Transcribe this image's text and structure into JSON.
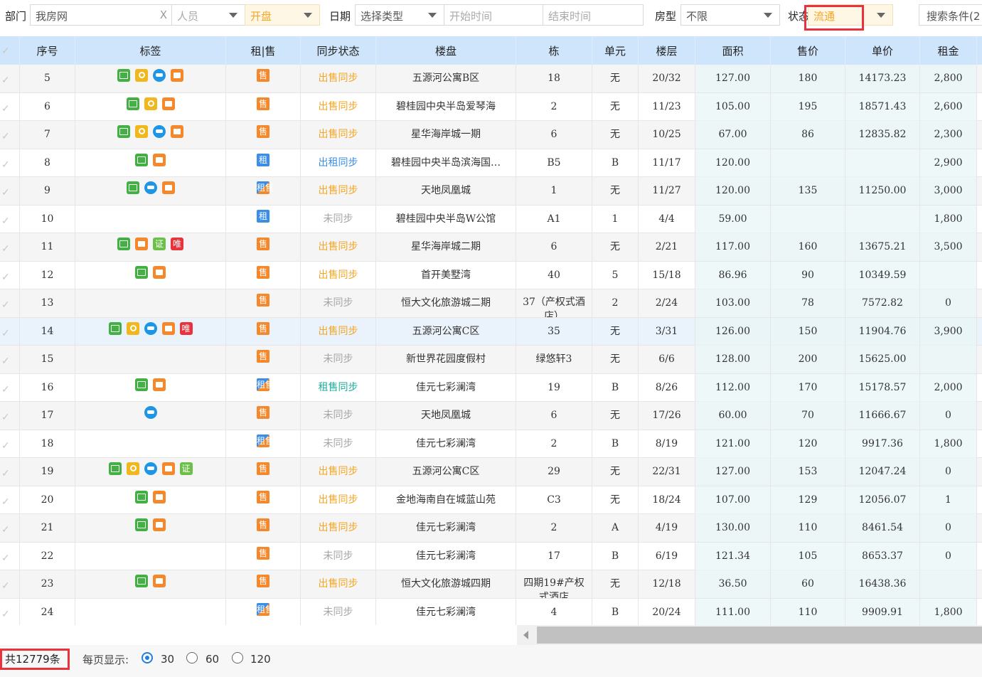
{
  "filters": {
    "dept_label": "部门",
    "dept_value": "我房网",
    "dept_clear": "X",
    "person_placeholder": "人员",
    "open_value": "开盘",
    "date_label": "日期",
    "date_type_placeholder": "选择类型",
    "start_placeholder": "开始时间",
    "end_placeholder": "结束时间",
    "room_label": "房型",
    "room_value": "不限",
    "status_label": "状态",
    "status_value": "流通",
    "search_label": "搜索条件(2"
  },
  "table": {
    "headers": [
      "序号",
      "标签",
      "租|售",
      "同步状态",
      "楼盘",
      "栋",
      "单元",
      "楼层",
      "面积",
      "售价",
      "单价",
      "租金"
    ],
    "rows": [
      {
        "no": "5",
        "tags": [
          "pic",
          "key",
          "hat",
          "vid"
        ],
        "type": "售",
        "type_cls": "sale",
        "sync": "出售同步",
        "sync_cls": "sync-sale",
        "estate": "五源河公寓B区",
        "building": "18",
        "unit": "无",
        "floor": "20/32",
        "area": "127.00",
        "price": "180",
        "unit_price": "14173.23",
        "rent": "2,800"
      },
      {
        "no": "6",
        "tags": [
          "pic",
          "key",
          "vid"
        ],
        "type": "售",
        "type_cls": "sale",
        "sync": "出售同步",
        "sync_cls": "sync-sale",
        "estate": "碧桂园中央半岛爱琴海",
        "building": "2",
        "unit": "无",
        "floor": "11/23",
        "area": "105.00",
        "price": "195",
        "unit_price": "18571.43",
        "rent": "2,600"
      },
      {
        "no": "7",
        "tags": [
          "pic",
          "key",
          "hat",
          "vid"
        ],
        "type": "售",
        "type_cls": "sale",
        "sync": "出售同步",
        "sync_cls": "sync-sale",
        "estate": "星华海岸城一期",
        "building": "6",
        "unit": "无",
        "floor": "10/25",
        "area": "67.00",
        "price": "86",
        "unit_price": "12835.82",
        "rent": "2,300"
      },
      {
        "no": "8",
        "tags": [
          "pic",
          "vid"
        ],
        "type": "租",
        "type_cls": "rent",
        "sync": "出租同步",
        "sync_cls": "sync-rent",
        "estate": "碧桂园中央半岛滨海国…",
        "building": "B5",
        "unit": "B",
        "floor": "11/17",
        "area": "120.00",
        "price": "",
        "unit_price": "",
        "rent": "2,900"
      },
      {
        "no": "9",
        "tags": [
          "pic",
          "hat",
          "vid"
        ],
        "type": "租售",
        "type_cls": "both",
        "sync": "出售同步",
        "sync_cls": "sync-sale",
        "estate": "天地凤凰城",
        "building": "1",
        "unit": "无",
        "floor": "11/27",
        "area": "120.00",
        "price": "135",
        "unit_price": "11250.00",
        "rent": "3,000"
      },
      {
        "no": "10",
        "tags": [],
        "type": "租",
        "type_cls": "rent",
        "sync": "未同步",
        "sync_cls": "sync-none",
        "estate": "碧桂园中央半岛W公馆",
        "building": "A1",
        "unit": "1",
        "floor": "4/4",
        "area": "59.00",
        "price": "",
        "unit_price": "",
        "rent": "1,800"
      },
      {
        "no": "11",
        "tags": [
          "pic",
          "vid",
          "cert",
          "only"
        ],
        "type": "售",
        "type_cls": "sale",
        "sync": "出售同步",
        "sync_cls": "sync-sale",
        "estate": "星华海岸城二期",
        "building": "6",
        "unit": "无",
        "floor": "2/21",
        "area": "117.00",
        "price": "160",
        "unit_price": "13675.21",
        "rent": "3,500"
      },
      {
        "no": "12",
        "tags": [
          "pic",
          "vid"
        ],
        "type": "售",
        "type_cls": "sale",
        "sync": "出售同步",
        "sync_cls": "sync-sale",
        "estate": "首开美墅湾",
        "building": "40",
        "unit": "5",
        "floor": "15/18",
        "area": "86.96",
        "price": "90",
        "unit_price": "10349.59",
        "rent": ""
      },
      {
        "no": "13",
        "tags": [],
        "type": "售",
        "type_cls": "sale",
        "sync": "未同步",
        "sync_cls": "sync-none",
        "estate": "恒大文化旅游城二期",
        "building": "37（产权式酒店）",
        "unit": "2",
        "floor": "2/24",
        "area": "103.00",
        "price": "78",
        "unit_price": "7572.82",
        "rent": "0"
      },
      {
        "no": "14",
        "tags": [
          "pic",
          "key",
          "hat",
          "vid",
          "only"
        ],
        "type": "售",
        "type_cls": "sale",
        "sync": "出售同步",
        "sync_cls": "sync-sale",
        "estate": "五源河公寓C区",
        "building": "35",
        "unit": "无",
        "floor": "3/31",
        "area": "126.00",
        "price": "150",
        "unit_price": "11904.76",
        "rent": "3,900",
        "selected": true
      },
      {
        "no": "15",
        "tags": [],
        "type": "售",
        "type_cls": "sale",
        "sync": "未同步",
        "sync_cls": "sync-none",
        "estate": "新世界花园度假村",
        "building": "绿悠轩3",
        "unit": "无",
        "floor": "6/6",
        "area": "128.00",
        "price": "200",
        "unit_price": "15625.00",
        "rent": ""
      },
      {
        "no": "16",
        "tags": [
          "pic",
          "vid"
        ],
        "type": "租售",
        "type_cls": "both",
        "sync": "租售同步",
        "sync_cls": "sync-both",
        "estate": "佳元七彩澜湾",
        "building": "19",
        "unit": "B",
        "floor": "8/26",
        "area": "112.00",
        "price": "170",
        "unit_price": "15178.57",
        "rent": "2,000"
      },
      {
        "no": "17",
        "tags": [
          "hat"
        ],
        "type": "售",
        "type_cls": "sale",
        "sync": "未同步",
        "sync_cls": "sync-none",
        "estate": "天地凤凰城",
        "building": "6",
        "unit": "无",
        "floor": "17/26",
        "area": "60.00",
        "price": "70",
        "unit_price": "11666.67",
        "rent": "0"
      },
      {
        "no": "18",
        "tags": [],
        "type": "租售",
        "type_cls": "both",
        "sync": "未同步",
        "sync_cls": "sync-none",
        "estate": "佳元七彩澜湾",
        "building": "2",
        "unit": "B",
        "floor": "8/19",
        "area": "121.00",
        "price": "120",
        "unit_price": "9917.36",
        "rent": "1,800"
      },
      {
        "no": "19",
        "tags": [
          "pic",
          "key",
          "hat",
          "vid",
          "cert"
        ],
        "type": "售",
        "type_cls": "sale",
        "sync": "出售同步",
        "sync_cls": "sync-sale",
        "estate": "五源河公寓C区",
        "building": "29",
        "unit": "无",
        "floor": "22/31",
        "area": "127.00",
        "price": "153",
        "unit_price": "12047.24",
        "rent": "0"
      },
      {
        "no": "20",
        "tags": [
          "pic",
          "vid"
        ],
        "type": "售",
        "type_cls": "sale",
        "sync": "出售同步",
        "sync_cls": "sync-sale",
        "estate": "金地海南自在城蓝山苑",
        "building": "C3",
        "unit": "无",
        "floor": "18/24",
        "area": "107.00",
        "price": "129",
        "unit_price": "12056.07",
        "rent": "1"
      },
      {
        "no": "21",
        "tags": [
          "pic",
          "vid"
        ],
        "type": "售",
        "type_cls": "sale",
        "sync": "出售同步",
        "sync_cls": "sync-sale",
        "estate": "佳元七彩澜湾",
        "building": "2",
        "unit": "A",
        "floor": "4/19",
        "area": "130.00",
        "price": "110",
        "unit_price": "8461.54",
        "rent": "0"
      },
      {
        "no": "22",
        "tags": [],
        "type": "售",
        "type_cls": "sale",
        "sync": "未同步",
        "sync_cls": "sync-none",
        "estate": "佳元七彩澜湾",
        "building": "17",
        "unit": "B",
        "floor": "6/19",
        "area": "121.34",
        "price": "105",
        "unit_price": "8653.37",
        "rent": "0"
      },
      {
        "no": "23",
        "tags": [
          "pic",
          "vid"
        ],
        "type": "售",
        "type_cls": "sale",
        "sync": "出售同步",
        "sync_cls": "sync-sale",
        "estate": "恒大文化旅游城四期",
        "building": "四期19#产权式酒店",
        "unit": "无",
        "floor": "12/18",
        "area": "36.50",
        "price": "60",
        "unit_price": "16438.36",
        "rent": ""
      },
      {
        "no": "24",
        "tags": [],
        "type": "租售",
        "type_cls": "both",
        "sync": "未同步",
        "sync_cls": "sync-none",
        "estate": "佳元七彩澜湾",
        "building": "4",
        "unit": "B",
        "floor": "20/24",
        "area": "111.00",
        "price": "110",
        "unit_price": "9909.91",
        "rent": "1,800"
      }
    ]
  },
  "footer": {
    "total": "共12779条",
    "per_page_label": "每页显示:",
    "options": [
      "30",
      "60",
      "120"
    ],
    "selected": "30"
  },
  "colors": {
    "header_bg": "#cfe5fb",
    "sale_sync": "#f5a623",
    "rent_sync": "#3a8ee6",
    "both_sync": "#1fae9e",
    "highlight": "#e8323c"
  }
}
